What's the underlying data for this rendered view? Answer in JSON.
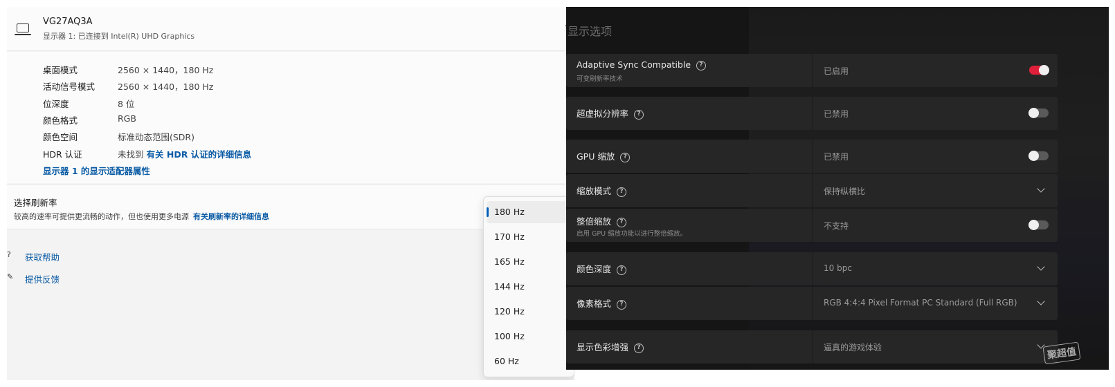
{
  "left": {
    "header": {
      "title": "VG27AQ3A",
      "subtitle": "显示器 1: 已连接到 Intel(R) UHD Graphics"
    },
    "properties": [
      {
        "key": "桌面模式",
        "value": "2560 × 1440，180 Hz"
      },
      {
        "key": "活动信号模式",
        "value": "2560 × 1440，180 Hz"
      },
      {
        "key": "位深度",
        "value": "8 位"
      },
      {
        "key": "颜色格式",
        "value": "RGB"
      },
      {
        "key": "颜色空间",
        "value": "标准动态范围(SDR)"
      },
      {
        "key": "HDR 认证",
        "value": "未找到",
        "link": "有关 HDR 认证的详细信息"
      }
    ],
    "adapter_link": "显示器 1 的显示适配器属性",
    "refresh": {
      "title": "选择刷新率",
      "description": "较高的速率可提供更流畅的动作，但也使用更多电源",
      "link": "有关刷新率的详细信息"
    },
    "help": {
      "get_help": "获取帮助",
      "feedback": "提供反馈"
    },
    "dropdown": {
      "options": [
        "180 Hz",
        "170 Hz",
        "165 Hz",
        "144 Hz",
        "120 Hz",
        "100 Hz",
        "60 Hz"
      ],
      "selected": "180 Hz"
    }
  },
  "right": {
    "title": "显示选项",
    "options": [
      {
        "label": "Adaptive Sync Compatible",
        "sub": "可变刷新率技术",
        "value": "已启用",
        "control": "toggle",
        "on": true
      },
      {
        "label": "超虚拟分辨率",
        "value": "已禁用",
        "control": "toggle",
        "on": false
      },
      {
        "label": "GPU 缩放",
        "value": "已禁用",
        "control": "toggle",
        "on": false
      },
      {
        "label": "缩放模式",
        "value": "保持纵横比",
        "control": "dropdown"
      },
      {
        "label": "整倍缩放",
        "sub": "启用 GPU 缩放功能以进行整倍缩放。",
        "value": "不支持",
        "control": "toggle",
        "on": false
      },
      {
        "label": "颜色深度",
        "value": "10 bpc",
        "control": "dropdown"
      },
      {
        "label": "像素格式",
        "value": "RGB 4:4:4 Pixel Format PC Standard (Full RGB)",
        "control": "dropdown"
      },
      {
        "label": "显示色彩增强",
        "value": "逼真的游戏体验",
        "control": "dropdown"
      }
    ],
    "watermark": "聚超值",
    "colors": {
      "toggle_on": "#e0203a",
      "panel_bg": "#262626",
      "link": "#0a5ba5"
    }
  }
}
